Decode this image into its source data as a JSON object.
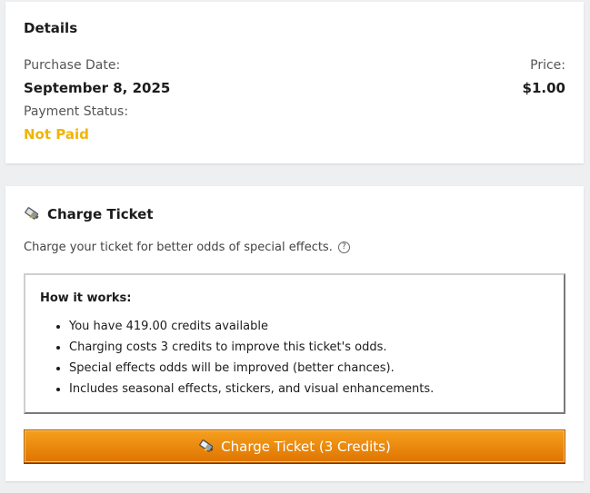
{
  "details": {
    "title": "Details",
    "purchase_date_label": "Purchase Date:",
    "purchase_date_value": "September 8, 2025",
    "price_label": "Price:",
    "price_value": "$1.00",
    "payment_status_label": "Payment Status:",
    "payment_status_value": "Not Paid"
  },
  "charge": {
    "icon": "battery-charge-icon",
    "title": "Charge Ticket",
    "description": "Charge your ticket for better odds of special effects.",
    "help_icon": "?",
    "how_it_works_title": "How it works:",
    "items": [
      "You have 419.00 credits available",
      "Charging costs 3 credits to improve this ticket's odds.",
      "Special effects odds will be improved (better chances).",
      "Includes seasonal effects, stickers, and visual enhancements."
    ],
    "button_label": "Charge Ticket (3 Credits)"
  },
  "colors": {
    "not_paid": "#f2b400",
    "button_top": "#f6a01e",
    "button_bottom": "#df7400"
  }
}
